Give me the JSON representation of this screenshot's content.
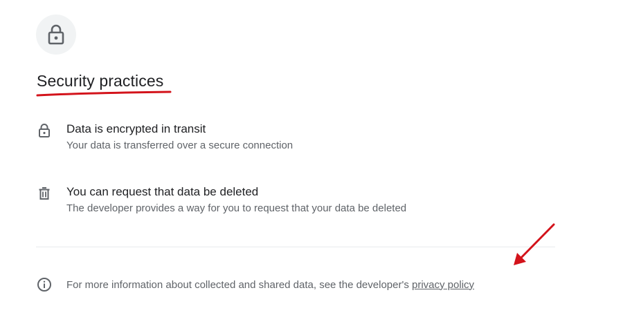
{
  "header": {
    "icon": "lock-icon",
    "title": "Security practices"
  },
  "practices": [
    {
      "icon": "lock-icon",
      "heading": "Data is encrypted in transit",
      "description": "Your data is transferred over a secure connection"
    },
    {
      "icon": "trash-icon",
      "heading": "You can request that data be deleted",
      "description": "The developer provides a way for you to request that your data be deleted"
    }
  ],
  "footer": {
    "icon": "info-icon",
    "text": "For more information about collected and shared data, see the developer's ",
    "link_label": "privacy policy"
  },
  "colors": {
    "annotation": "#d3131b",
    "icon": "#5f6368",
    "divider": "#e8eaed"
  }
}
